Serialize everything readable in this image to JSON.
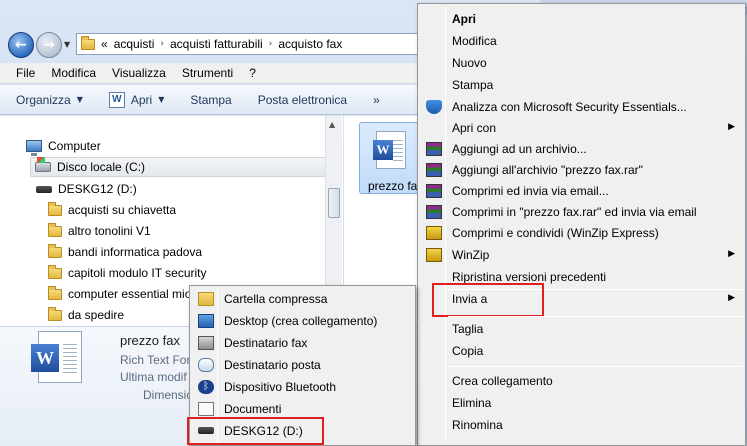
{
  "address_bar": {
    "overflow": "«",
    "path": [
      "acquisti",
      "acquisti fatturabili",
      "acquisto fax"
    ]
  },
  "menubar": [
    "File",
    "Modifica",
    "Visualizza",
    "Strumenti",
    "?"
  ],
  "toolbar": {
    "organize": "Organizza",
    "open": "Apri",
    "print": "Stampa",
    "email": "Posta elettronica",
    "more": "»"
  },
  "nav_tree": {
    "computer": "Computer",
    "local_disk": "Disco locale (C:)",
    "drive": "DESKG12 (D:)",
    "folders": [
      "acquisti su chiavetta",
      "altro tonolini V1",
      "bandi informatica padova",
      "capitoli modulo IT security",
      "computer essential mio",
      "da spedire"
    ]
  },
  "file_tile": {
    "name": "prezzo fa"
  },
  "details": {
    "name": "prezzo fax",
    "type": "Rich Text Form",
    "modified": "Ultima modif",
    "size": "Dimensio"
  },
  "context_menu": {
    "items": {
      "open": "Apri",
      "edit": "Modifica",
      "new": "Nuovo",
      "print": "Stampa",
      "scan": "Analizza con Microsoft Security Essentials...",
      "open_with": "Apri con",
      "add_archive": "Aggiungi ad un archivio...",
      "add_rar": "Aggiungi all'archivio \"prezzo fax.rar\"",
      "compress_email": "Comprimi ed invia via email...",
      "compress_rar_email": "Comprimi in \"prezzo fax.rar\" ed invia via email",
      "compress_share": "Comprimi e condividi (WinZip Express)",
      "winzip": "WinZip",
      "restore": "Ripristina versioni precedenti",
      "send_to": "Invia a",
      "cut": "Taglia",
      "copy": "Copia",
      "create_link": "Crea collegamento",
      "delete": "Elimina",
      "rename": "Rinomina"
    }
  },
  "send_to_menu": {
    "items": {
      "zip": "Cartella compressa",
      "desktop": "Desktop (crea collegamento)",
      "fax": "Destinatario fax",
      "mail": "Destinatario posta",
      "bluetooth": "Dispositivo Bluetooth",
      "documents": "Documenti",
      "drive": "DESKG12 (D:)"
    }
  },
  "highlight_color": "#e02020"
}
